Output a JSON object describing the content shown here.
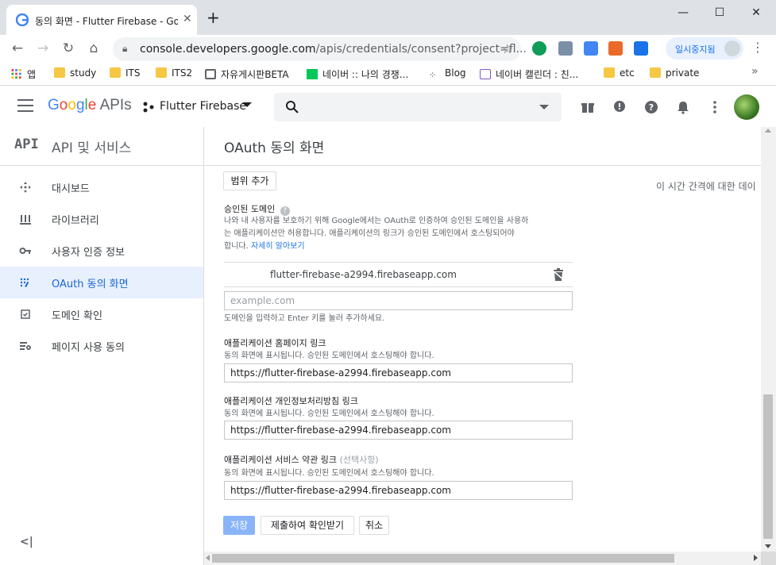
{
  "browser": {
    "tab_title": "동의 화면 - Flutter Firebase - Goo",
    "tab_close": "✕",
    "new_tab": "+",
    "window": {
      "minimize": "—",
      "maximize": "☐",
      "close": "✕"
    },
    "url_host": "console.developers.google.com",
    "url_path": "/apis/credentials/consent?project=fl...",
    "profile_status": "일시중지됨",
    "bookmarks": [
      "앱",
      "study",
      "ITS",
      "ITS2",
      "자유게시판BETA",
      "네이버 :: 나의 경쟁...",
      "Blog",
      "네이버 캘린더 : 친...",
      "etc",
      "private"
    ],
    "bookmarks_more": "»"
  },
  "header": {
    "logo_google": "Google",
    "logo_apis": "APIs",
    "project_name": "Flutter Firebase"
  },
  "sidebar": {
    "api_badge": "API",
    "title": "API 및 서비스",
    "items": [
      {
        "label": "대시보드",
        "icon": "dashboard-icon"
      },
      {
        "label": "라이브러리",
        "icon": "library-icon"
      },
      {
        "label": "사용자 인증 정보",
        "icon": "key-icon"
      },
      {
        "label": "OAuth 동의 화면",
        "icon": "consent-icon",
        "active": true
      },
      {
        "label": "도메인 확인",
        "icon": "domain-check-icon"
      },
      {
        "label": "페이지 사용 동의",
        "icon": "page-consent-icon"
      }
    ],
    "collapse": "<|"
  },
  "main": {
    "title": "OAuth 동의 화면",
    "add_scope": "범위 추가",
    "right_note": "이 시간 간격에 대한 데이",
    "authorized_domains": {
      "title": "승인된 도메인",
      "desc_1": "나와 내 사용자를 보호하기 위해 Google에서는 OAuth로 인증하여 승인된 도메인을 사용하",
      "desc_2": "는 애플리케이션만 허용합니다. 애플리케이션의 링크가 승인된 도메인에서 호스팅되어야",
      "desc_3": "합니다.",
      "learn_more": "자세히 알아보기",
      "domain_value": "flutter-firebase-a2994.firebaseapp.com",
      "input_placeholder": "example.com",
      "input_hint": "도메인을 입력하고 Enter 키를 눌러 추가하세요."
    },
    "homepage_link": {
      "title": "애플리케이션 홈페이지 링크",
      "desc": "동의 화면에 표시됩니다. 승인된 도메인에서 호스팅해야 합니다.",
      "value": "https://flutter-firebase-a2994.firebaseapp.com"
    },
    "privacy_link": {
      "title": "애플리케이션 개인정보처리방침 링크",
      "desc": "동의 화면에 표시됩니다. 승인된 도메인에서 호스팅해야 합니다.",
      "value": "https://flutter-firebase-a2994.firebaseapp.com"
    },
    "tos_link": {
      "title": "애플리케이션 서비스 약관 링크",
      "optional": "(선택사항)",
      "desc": "동의 화면에 표시됩니다. 승인된 도메인에서 호스팅해야 합니다.",
      "value": "https://flutter-firebase-a2994.firebaseapp.com"
    },
    "buttons": {
      "save": "저장",
      "submit": "제출하여 확인받기",
      "cancel": "취소"
    }
  },
  "colors": {
    "accent": "#1a73e8",
    "active_bg": "#e8f0fe",
    "primary_button": "#8ab4f8"
  }
}
